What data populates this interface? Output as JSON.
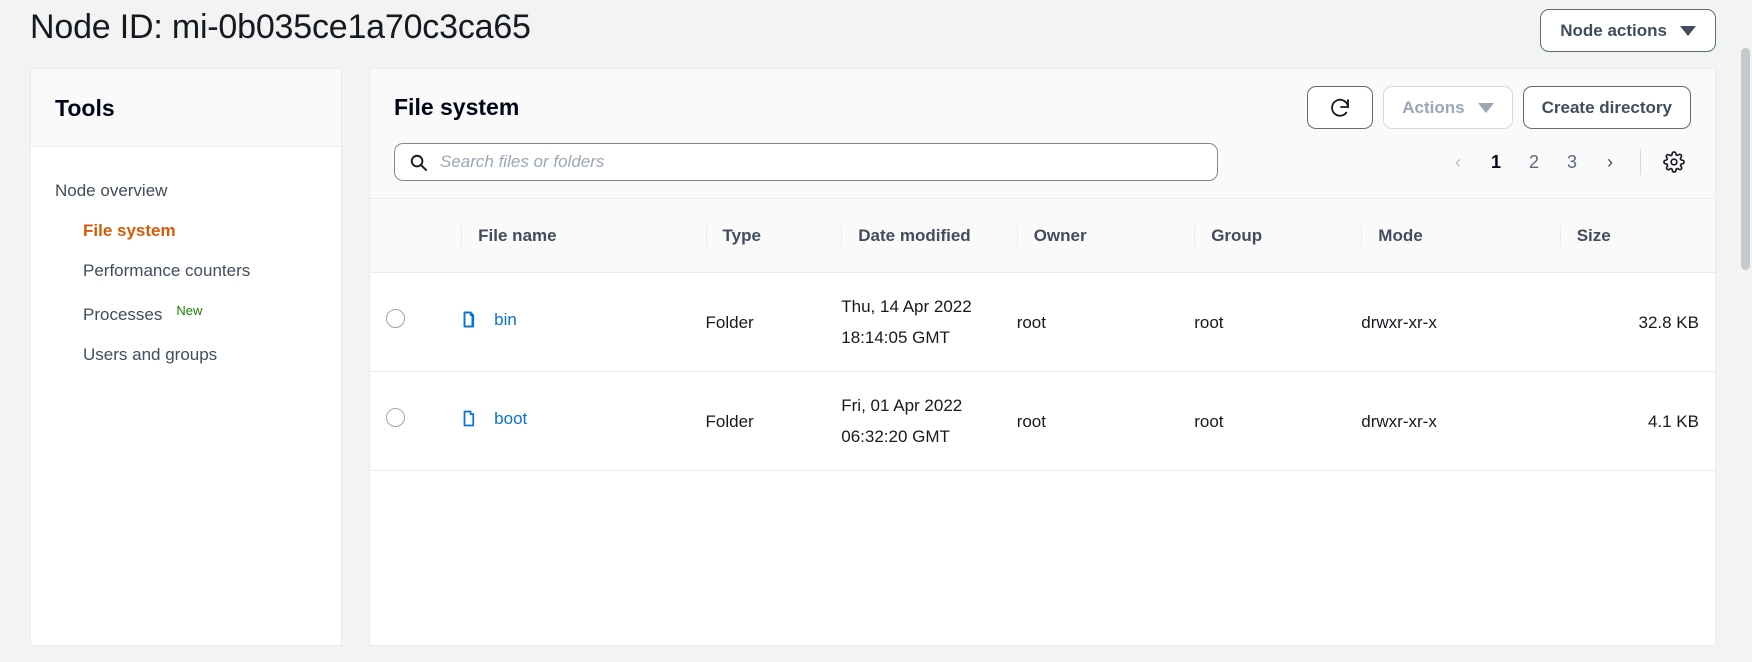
{
  "header": {
    "title": "Node ID: mi-0b035ce1a70c3ca65",
    "node_actions_label": "Node actions"
  },
  "sidebar": {
    "title": "Tools",
    "items": [
      {
        "label": "Node overview",
        "active": false,
        "badge": ""
      },
      {
        "label": "File system",
        "active": true,
        "badge": ""
      },
      {
        "label": "Performance counters",
        "active": false,
        "badge": ""
      },
      {
        "label": "Processes",
        "active": false,
        "badge": "New"
      },
      {
        "label": "Users and groups",
        "active": false,
        "badge": ""
      }
    ],
    "item_0_label": "Node overview",
    "item_1_label": "File system",
    "item_2_label": "Performance counters",
    "item_3_label": "Processes",
    "item_3_badge": "New",
    "item_4_label": "Users and groups"
  },
  "filesystem": {
    "title": "File system",
    "refresh_icon": "refresh-icon",
    "actions_label": "Actions",
    "actions_disabled": true,
    "create_directory_label": "Create directory",
    "search": {
      "placeholder": "Search files or folders",
      "value": "",
      "icon": "search-icon"
    },
    "pagination": {
      "prev_label": "‹",
      "next_label": "›",
      "pages": [
        "1",
        "2",
        "3"
      ],
      "current_page": "1",
      "page_1": "1",
      "page_2": "2",
      "page_3": "3",
      "settings_icon": "gear-icon"
    },
    "columns": {
      "select": "",
      "file_name": "File name",
      "type": "Type",
      "date_modified": "Date modified",
      "owner": "Owner",
      "group": "Group",
      "mode": "Mode",
      "size": "Size"
    },
    "rows": [
      {
        "name": "bin",
        "icon": "folder-icon",
        "type": "Folder",
        "date_modified": "Thu, 14 Apr 2022 18:14:05 GMT",
        "owner": "root",
        "group": "root",
        "mode": "drwxr-xr-x",
        "size": "32.8 KB",
        "selected": false
      },
      {
        "name": "boot",
        "icon": "folder-icon",
        "type": "Folder",
        "date_modified": "Fri, 01 Apr 2022 06:32:20 GMT",
        "owner": "root",
        "group": "root",
        "mode": "drwxr-xr-x",
        "size": "4.1 KB",
        "selected": false
      }
    ],
    "row_0": {
      "name": "bin",
      "type": "Folder",
      "date_modified": "Thu, 14 Apr 2022 18:14:05 GMT",
      "owner": "root",
      "group": "root",
      "mode": "drwxr-xr-x",
      "size": "32.8 KB"
    },
    "row_1": {
      "name": "boot",
      "type": "Folder",
      "date_modified": "Fri, 01 Apr 2022 06:32:20 GMT",
      "owner": "root",
      "group": "root",
      "mode": "drwxr-xr-x",
      "size": "4.1 KB"
    }
  },
  "colors": {
    "accent_selected": "#d45b07",
    "link_blue": "#0972d3",
    "badge_green": "#1d8102",
    "page_background": "#f2f3f3",
    "panel_background": "#ffffff",
    "header_background": "#fafafa",
    "border": "#e9ebed",
    "text_primary": "#16191f",
    "text_secondary": "#414d5c",
    "text_muted": "#9ba7b6"
  }
}
